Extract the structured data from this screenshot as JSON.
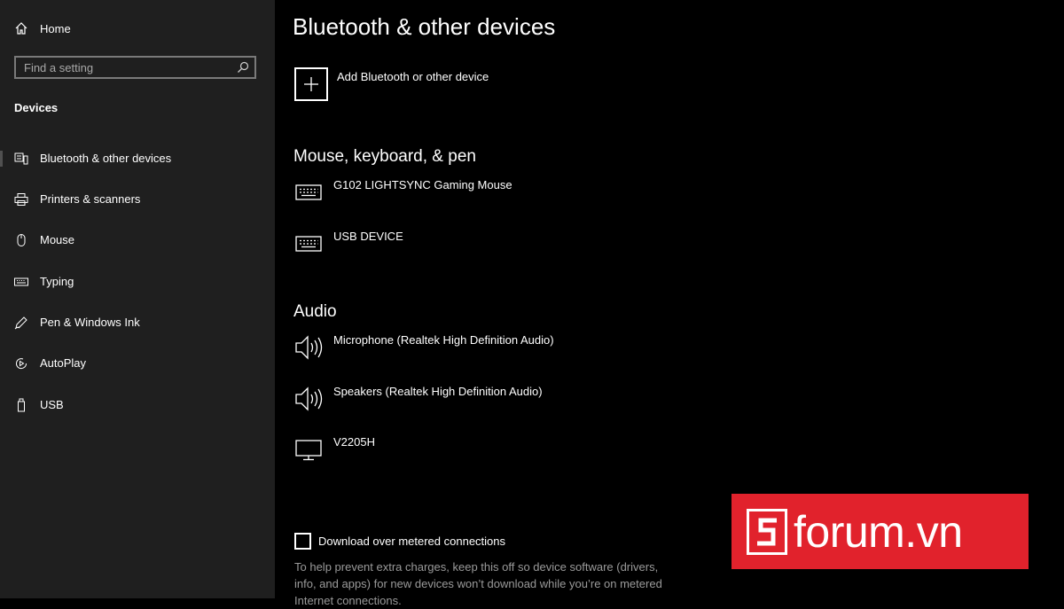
{
  "sidebar": {
    "home_label": "Home",
    "search_placeholder": "Find a setting",
    "section_label": "Devices",
    "items": [
      {
        "label": "Bluetooth & other devices",
        "icon": "bluetooth-devices-icon",
        "selected": true
      },
      {
        "label": "Printers & scanners",
        "icon": "printer-icon"
      },
      {
        "label": "Mouse",
        "icon": "mouse-icon"
      },
      {
        "label": "Typing",
        "icon": "keyboard-icon"
      },
      {
        "label": "Pen & Windows Ink",
        "icon": "pen-icon"
      },
      {
        "label": "AutoPlay",
        "icon": "autoplay-icon"
      },
      {
        "label": "USB",
        "icon": "usb-icon"
      }
    ]
  },
  "main": {
    "title": "Bluetooth & other devices",
    "add_device_label": "Add Bluetooth or other device",
    "groups": [
      {
        "title": "Mouse, keyboard, & pen",
        "devices": [
          {
            "name": "G102 LIGHTSYNC Gaming Mouse",
            "icon": "keyboard-icon"
          },
          {
            "name": "USB DEVICE",
            "icon": "keyboard-icon"
          }
        ]
      },
      {
        "title": "Audio",
        "devices": [
          {
            "name": "Microphone (Realtek High Definition Audio)",
            "icon": "speaker-icon"
          },
          {
            "name": "Speakers (Realtek High Definition Audio)",
            "icon": "speaker-icon"
          },
          {
            "name": "V2205H",
            "icon": "monitor-icon"
          }
        ]
      }
    ],
    "metered": {
      "label": "Download over metered connections",
      "checked": false,
      "help_text": "To help prevent extra charges, keep this off so device software (drivers, info, and apps) for new devices won’t download while you’re on metered Internet connections."
    }
  },
  "watermark": {
    "text": "forum.vn",
    "color": "#e1222c"
  },
  "colors": {
    "sidebar_bg": "#1f1f1f",
    "main_bg": "#000000"
  }
}
